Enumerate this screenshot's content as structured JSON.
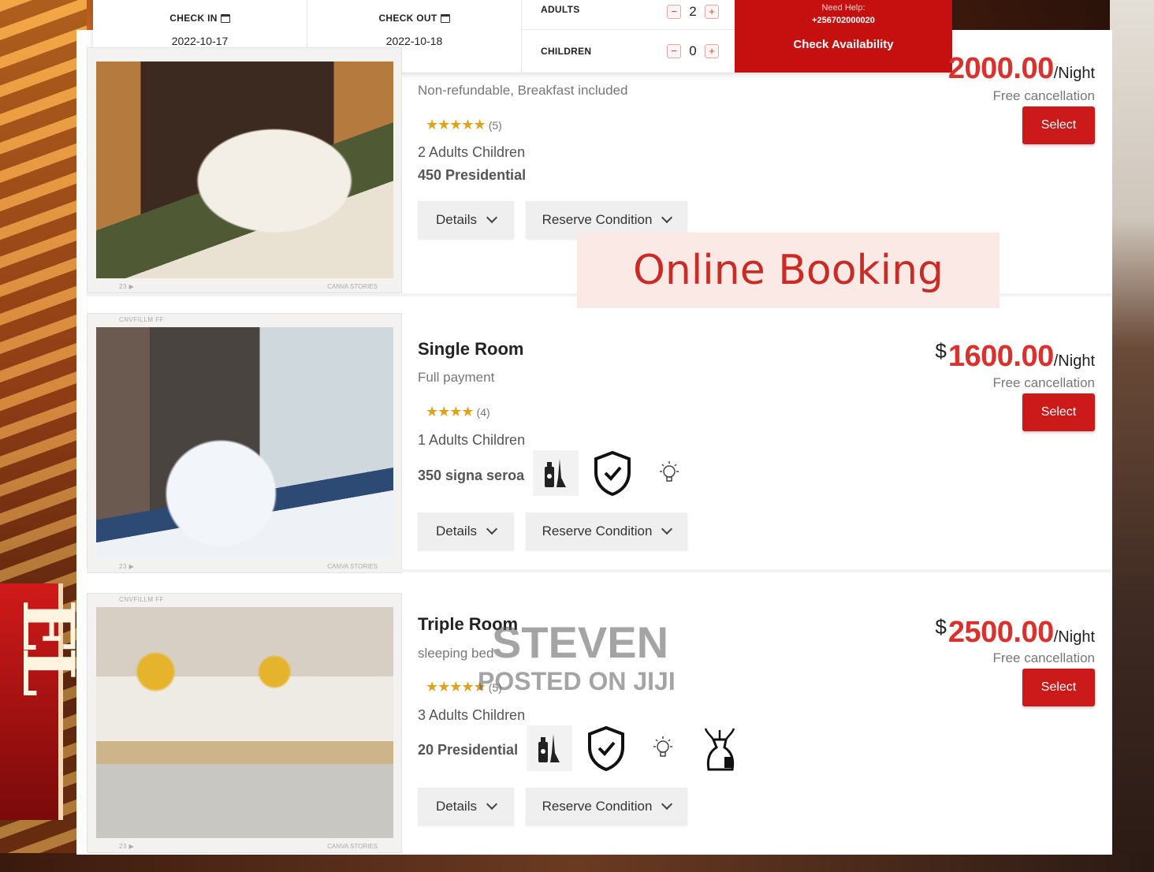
{
  "booking": {
    "check_in_label": "CHECK IN",
    "check_in_value": "2022-10-17",
    "check_out_label": "CHECK OUT",
    "check_out_value": "2022-10-18",
    "adults_label": "ADULTS",
    "adults_value": "2",
    "children_label": "CHILDREN",
    "children_value": "0",
    "minus": "−",
    "plus": "+",
    "help_label": "Need Help:",
    "help_phone": "+256702000020",
    "cta": "Check Availability"
  },
  "rooms": [
    {
      "title": "",
      "subtitle": "Non-refundable, Breakfast included",
      "stars": "★★★★★",
      "rating_count": "(5)",
      "capacity": "2 Adults  Children",
      "room_info": "450 Presidential",
      "currency": "",
      "price": "2000.00",
      "per": "/Night",
      "cancellation": "Free cancellation",
      "select": "Select",
      "details": "Details",
      "reserve": "Reserve Condition",
      "amenities": []
    },
    {
      "title": "Single Room",
      "subtitle": "Full payment",
      "stars": "★★★★",
      "rating_count": "(4)",
      "capacity": "1 Adults  Children",
      "room_info": "350  signa seroa",
      "currency": "$",
      "price": "1600.00",
      "per": "/Night",
      "cancellation": "Free cancellation",
      "select": "Select",
      "details": "Details",
      "reserve": "Reserve Condition",
      "amenities": [
        "cleaning-icon",
        "shield-check-icon",
        "light-bulb-icon"
      ]
    },
    {
      "title": "Triple Room",
      "subtitle": "sleeping bed",
      "stars": "★★★★★",
      "rating_count": "(5)",
      "capacity": "3 Adults  Children",
      "room_info": "20 Presidential",
      "currency": "$",
      "price": "2500.00",
      "per": "/Night",
      "cancellation": "Free cancellation",
      "select": "Select",
      "details": "Details",
      "reserve": "Reserve Condition",
      "amenities": [
        "cleaning-icon",
        "shield-check-icon",
        "light-bulb-icon",
        "spray-bottle-icon"
      ]
    }
  ],
  "photo_caption": {
    "top": "CNVFILLM FF",
    "bottom_left": "23  ▶",
    "bottom_right": "CANVA STORIES"
  },
  "overlay": "Online Booking",
  "watermark": {
    "line1": "STEVEN",
    "line2": "POSTED ON JIJI"
  },
  "colors": {
    "accent": "#cc1a1a",
    "price": "#d9322e",
    "star": "#e0a21a"
  }
}
